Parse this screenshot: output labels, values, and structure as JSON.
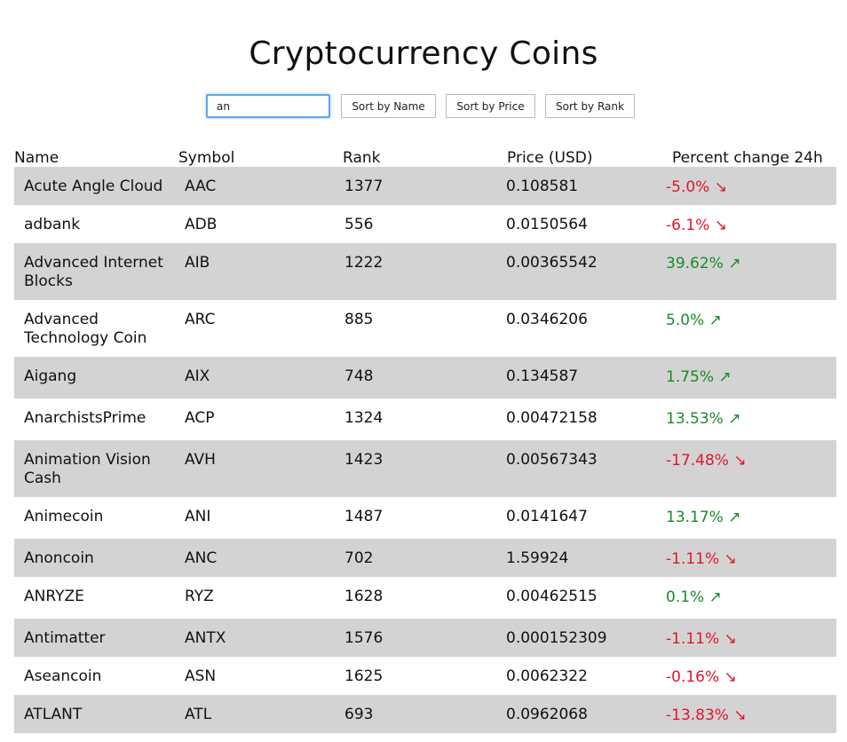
{
  "title": "Cryptocurrency Coins",
  "search": {
    "value": "an"
  },
  "buttons": {
    "sort_name": "Sort by Name",
    "sort_price": "Sort by Price",
    "sort_rank": "Sort by Rank"
  },
  "columns": {
    "name": "Name",
    "symbol": "Symbol",
    "rank": "Rank",
    "price": "Price (USD)",
    "change": "Percent change 24h"
  },
  "colors": {
    "up": "#1a8a2a",
    "down": "#e0162b",
    "row_shade": "#d3d3d3"
  },
  "rows": [
    {
      "name": "Acute Angle Cloud",
      "symbol": "AAC",
      "rank": "1377",
      "price": "0.108581",
      "change": "-5.0% ↘",
      "direction": "down"
    },
    {
      "name": "adbank",
      "symbol": "ADB",
      "rank": "556",
      "price": "0.0150564",
      "change": "-6.1% ↘",
      "direction": "down"
    },
    {
      "name": "Advanced Internet Blocks",
      "symbol": "AIB",
      "rank": "1222",
      "price": "0.00365542",
      "change": "39.62% ↗",
      "direction": "up"
    },
    {
      "name": "Advanced Technology Coin",
      "symbol": "ARC",
      "rank": "885",
      "price": "0.0346206",
      "change": "5.0% ↗",
      "direction": "up"
    },
    {
      "name": "Aigang",
      "symbol": "AIX",
      "rank": "748",
      "price": "0.134587",
      "change": "1.75% ↗",
      "direction": "up"
    },
    {
      "name": "AnarchistsPrime",
      "symbol": "ACP",
      "rank": "1324",
      "price": "0.00472158",
      "change": "13.53% ↗",
      "direction": "up"
    },
    {
      "name": "Animation Vision Cash",
      "symbol": "AVH",
      "rank": "1423",
      "price": "0.00567343",
      "change": "-17.48% ↘",
      "direction": "down"
    },
    {
      "name": "Animecoin",
      "symbol": "ANI",
      "rank": "1487",
      "price": "0.0141647",
      "change": "13.17% ↗",
      "direction": "up"
    },
    {
      "name": "Anoncoin",
      "symbol": "ANC",
      "rank": "702",
      "price": "1.59924",
      "change": "-1.11% ↘",
      "direction": "down"
    },
    {
      "name": "ANRYZE",
      "symbol": "RYZ",
      "rank": "1628",
      "price": "0.00462515",
      "change": "0.1% ↗",
      "direction": "up"
    },
    {
      "name": "Antimatter",
      "symbol": "ANTX",
      "rank": "1576",
      "price": "0.000152309",
      "change": "-1.11% ↘",
      "direction": "down"
    },
    {
      "name": "Aseancoin",
      "symbol": "ASN",
      "rank": "1625",
      "price": "0.0062322",
      "change": "-0.16% ↘",
      "direction": "down"
    },
    {
      "name": "ATLANT",
      "symbol": "ATL",
      "rank": "693",
      "price": "0.0962068",
      "change": "-13.83% ↘",
      "direction": "down"
    }
  ]
}
